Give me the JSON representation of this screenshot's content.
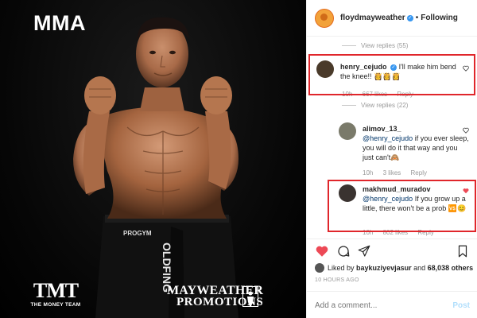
{
  "photo": {
    "corner_label": "MMA",
    "tmt_logo": "TMT",
    "tmt_sub": "THE MONEY TEAM",
    "promo_line1": "MAYWEATHER",
    "promo_line2": "PROMOTIONS",
    "shorts_text": "OLDFING"
  },
  "header": {
    "username": "floydmayweather",
    "separator": "•",
    "follow_label": "Following"
  },
  "thread": {
    "view_replies_top": "View replies (55)",
    "comments": [
      {
        "username": "henry_cejudo",
        "verified": true,
        "text": "I'll make him bend the knee!! 👸👸👸",
        "time": "10h",
        "likes": "667 likes",
        "reply": "Reply"
      },
      {
        "username": "alimov_13_",
        "mention": "@henry_cejudo",
        "text": "if you ever sleep, you will do it that way and you just can't🙈",
        "time": "10h",
        "likes": "3 likes",
        "reply": "Reply"
      },
      {
        "username": "makhmud_muradov",
        "mention": "@henry_cejudo",
        "text": "If you grow up a little, there won't be a prob 🆚😊",
        "time": "10h",
        "likes": "802 likes",
        "reply": "Reply"
      }
    ],
    "view_replies_mid": "View replies (22)"
  },
  "actions": {
    "liked_by_prefix": "Liked by",
    "liked_by_user": "baykuziyevjasur",
    "liked_by_suffix": "and",
    "likes_count": "68,038 others",
    "timestamp": "10 HOURS AGO",
    "add_comment_placeholder": "Add a comment...",
    "post_label": "Post"
  },
  "colors": {
    "highlight_red": "#e0262b",
    "like_red": "#ed4956",
    "verified_blue": "#3897f0"
  },
  "icons": [
    "heart-icon",
    "comment-icon",
    "share-icon",
    "bookmark-icon",
    "verified-icon"
  ]
}
